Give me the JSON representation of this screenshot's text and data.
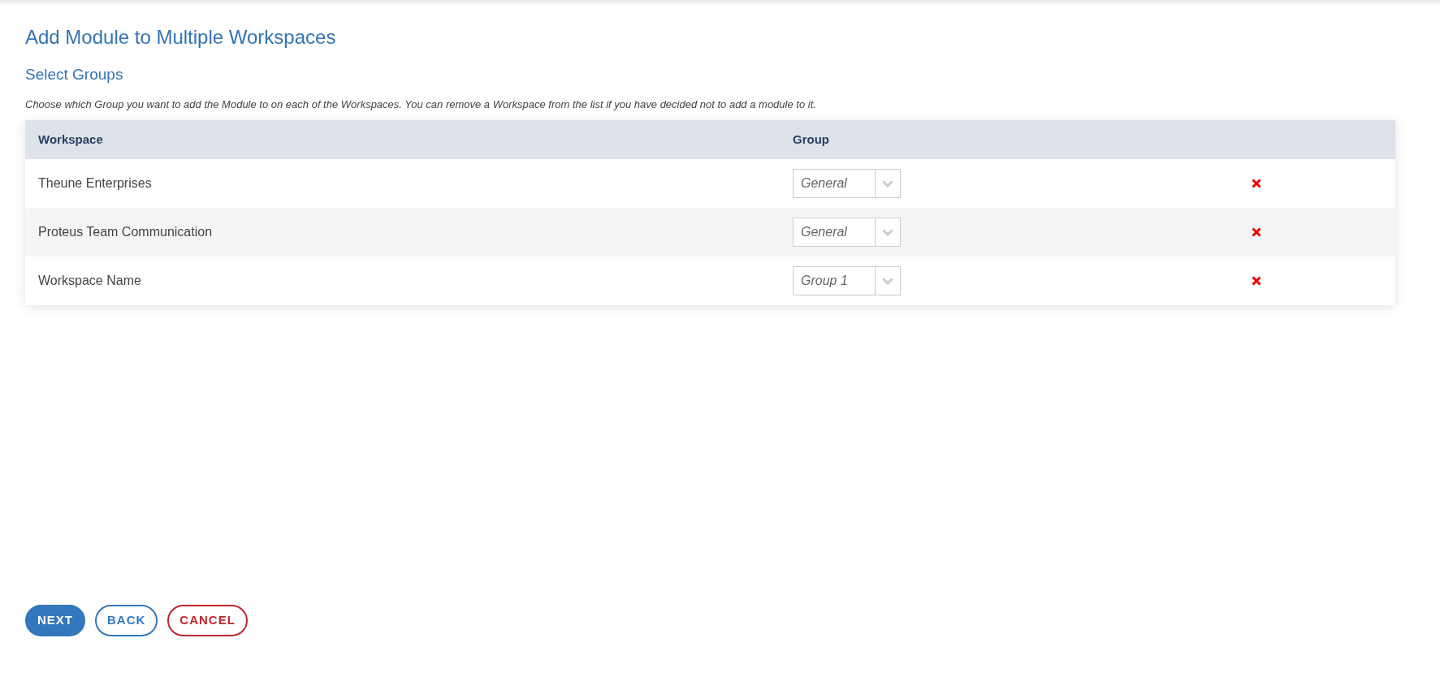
{
  "page": {
    "title": "Add Module to Multiple Workspaces",
    "subtitle": "Select Groups",
    "description": "Choose which Group you want to add the Module to on each of the Workspaces. You can remove a Workspace from the list if you have decided not to add a module to it."
  },
  "table": {
    "columns": [
      "Workspace",
      "Group"
    ],
    "rows": [
      {
        "workspace": "Theune Enterprises",
        "group": "General"
      },
      {
        "workspace": "Proteus Team Communication",
        "group": "General"
      },
      {
        "workspace": "Workspace Name",
        "group": "Group 1"
      }
    ]
  },
  "buttons": [
    {
      "label": "NEXT",
      "kind": "primary"
    },
    {
      "label": "BACK",
      "kind": "secondary"
    },
    {
      "label": "CANCEL",
      "kind": "danger"
    }
  ]
}
